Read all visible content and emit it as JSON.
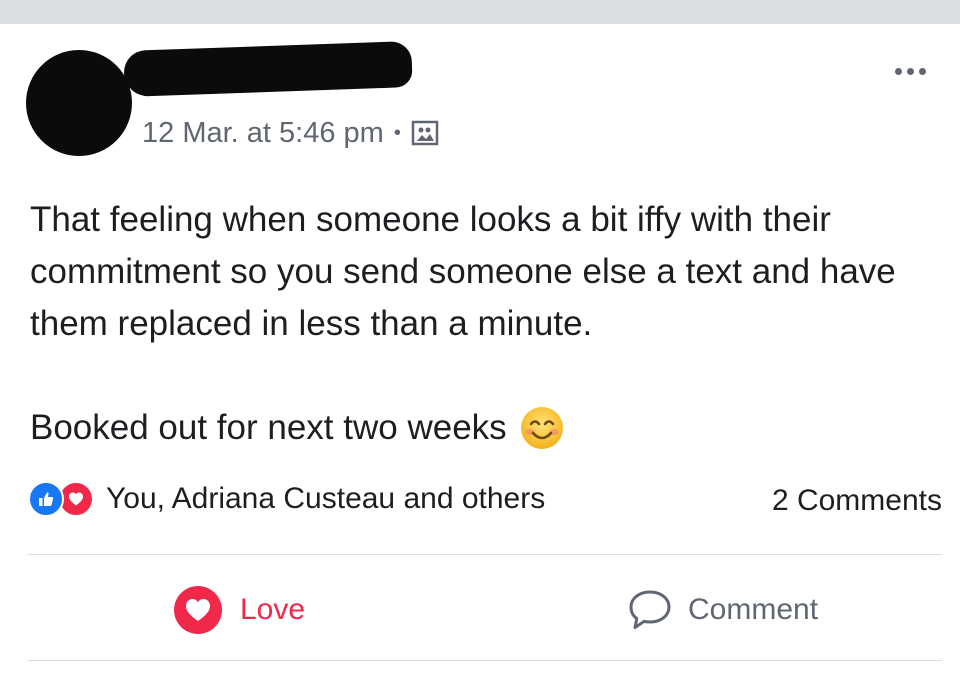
{
  "post": {
    "timestamp": "12 Mar. at 5:46 pm",
    "separator": "•",
    "audience_icon": "photo-album-icon",
    "more_icon": "more-options-icon",
    "text_line1": "That feeling when someone looks a bit iffy with their commitment so you send someone else a text and have them replaced in less than a minute.",
    "text_line2": "Booked out for next two weeks",
    "emoji": "smiling-face-emoji"
  },
  "reactions": {
    "icons": [
      "like-icon",
      "love-icon"
    ],
    "summary": "You, Adriana Custeau and others",
    "comments_count": "2 Comments"
  },
  "actions": {
    "love_label": "Love",
    "comment_label": "Comment"
  },
  "colors": {
    "love_red": "#f0284a",
    "like_blue": "#1877f2",
    "secondary_text": "#606770",
    "divider": "#dadde1"
  }
}
